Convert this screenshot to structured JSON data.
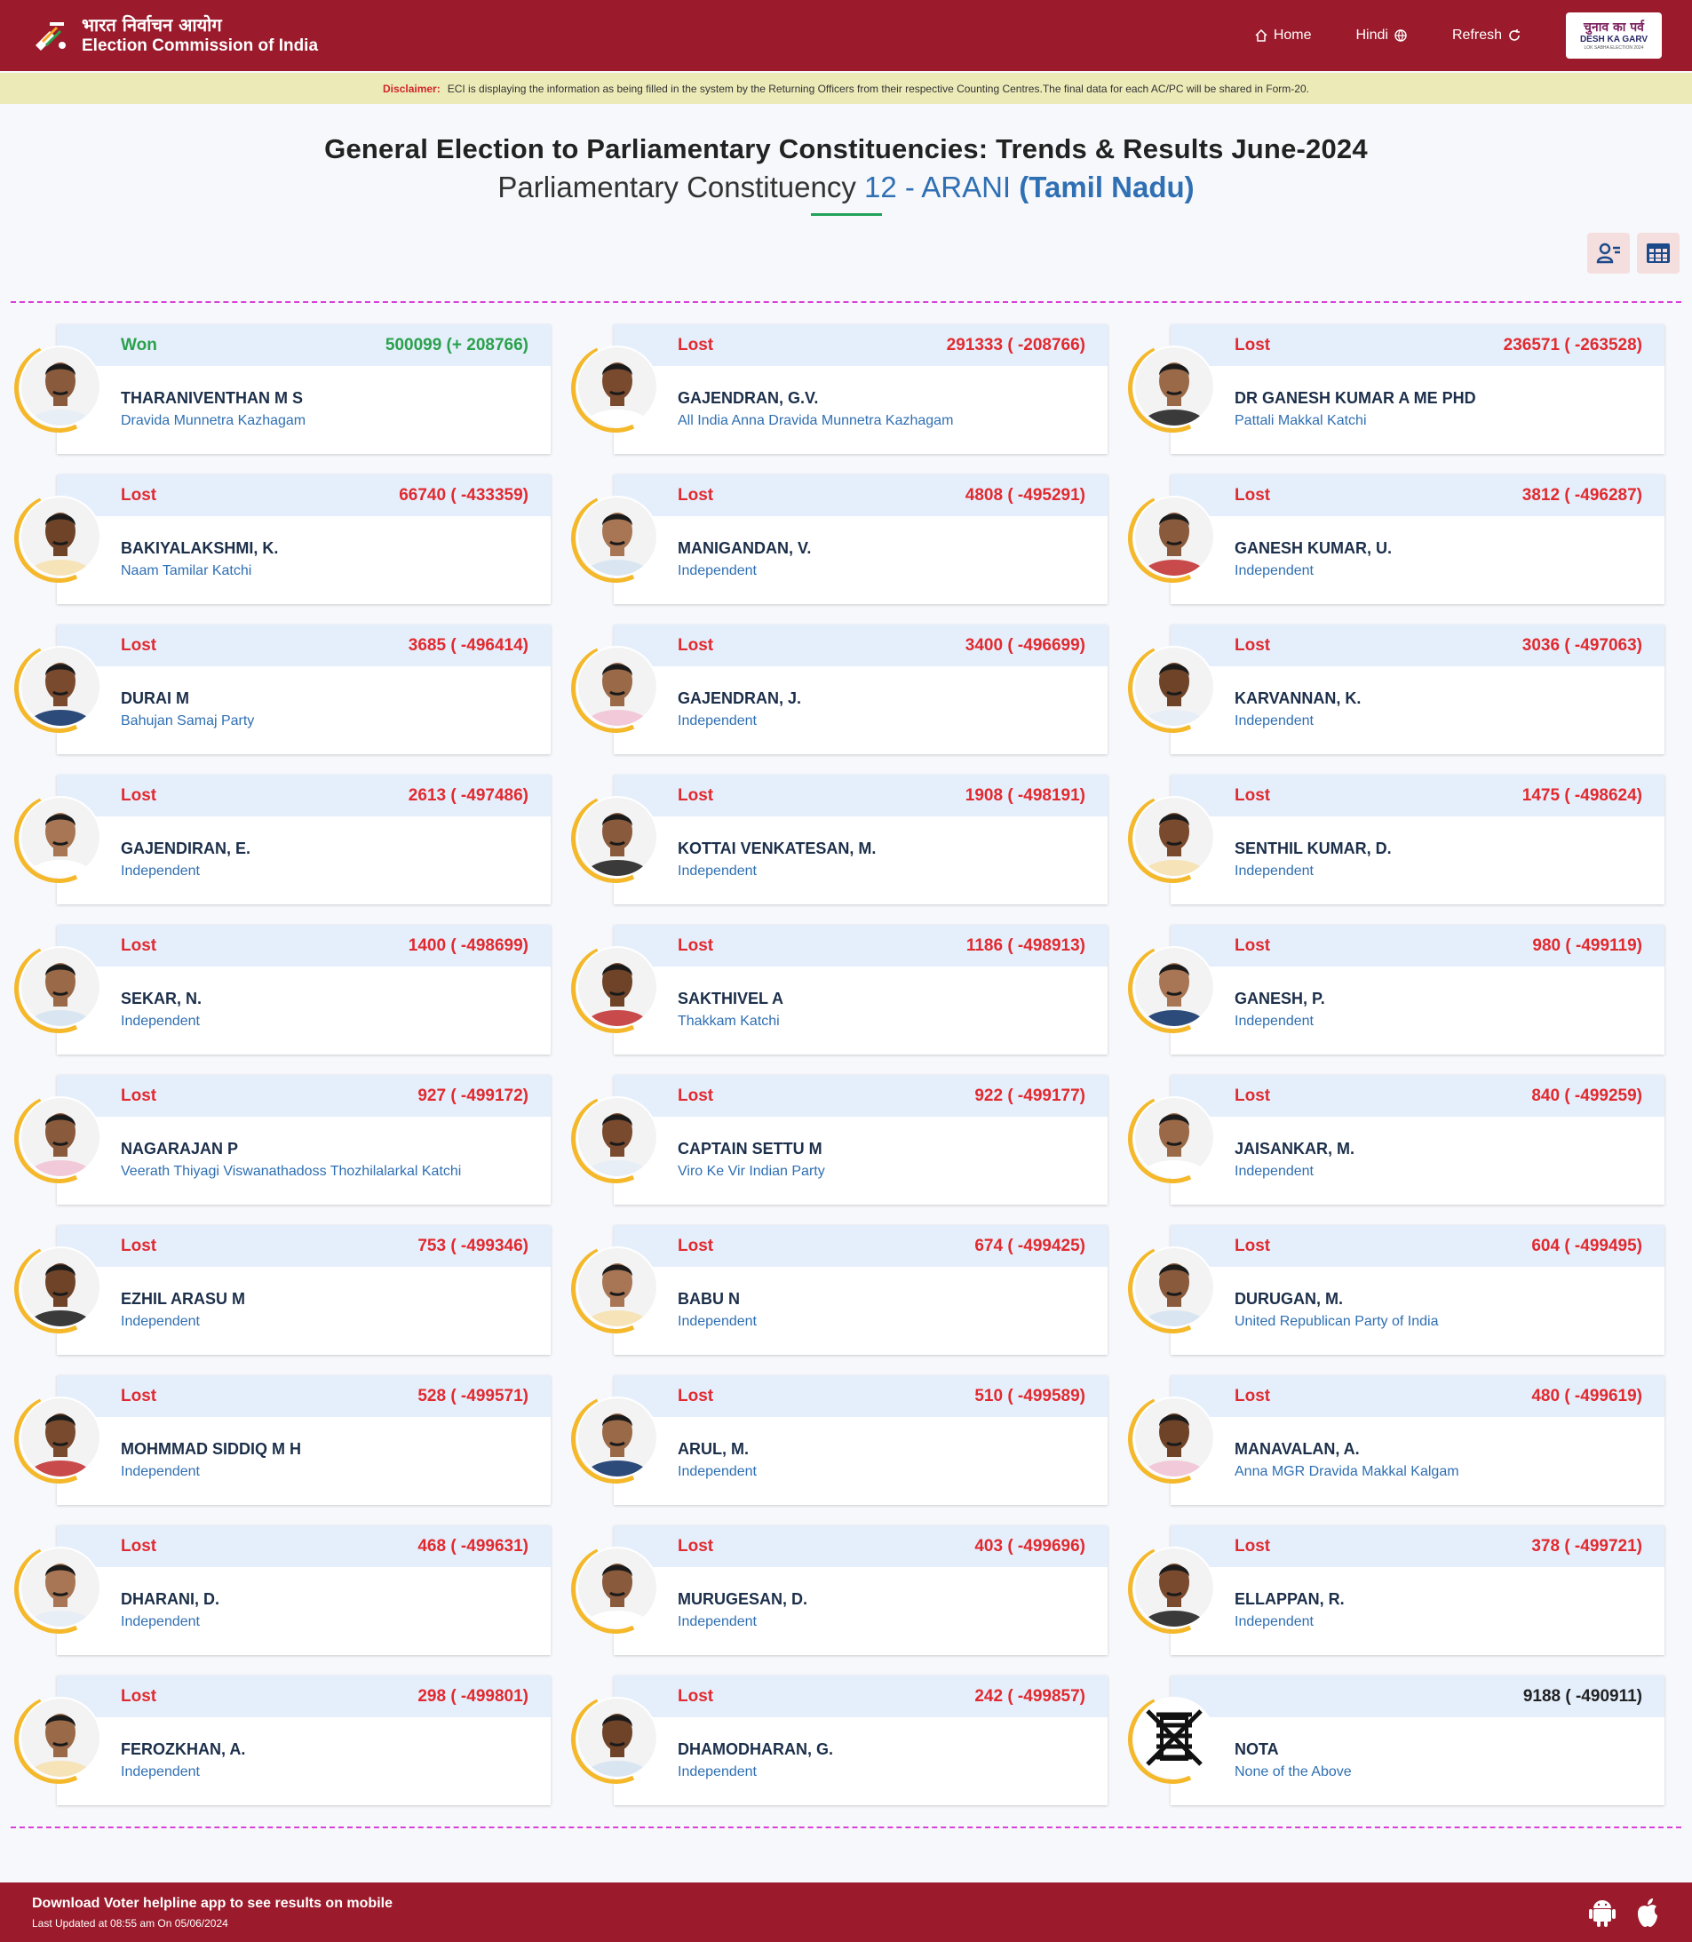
{
  "header": {
    "brand_hindi": "भारत निर्वाचन आयोग",
    "brand_english": "Election Commission of India",
    "nav": {
      "home": "Home",
      "hindi": "Hindi",
      "refresh": "Refresh"
    },
    "badge": {
      "hindi": "चुनाव का पर्व",
      "english": "DESH KA GARV",
      "small": "LOK SABHA ELECTION 2024"
    }
  },
  "disclaimer": {
    "label": "Disclaimer:",
    "text": "ECI is displaying the information as being filled in the system by the Returning Officers from their respective Counting Centres.The final data for each AC/PC will be shared in Form-20."
  },
  "title": {
    "line1": "General Election to Parliamentary Constituencies: Trends & Results June-2024",
    "line2_prefix": "Parliamentary Constituency ",
    "line2_number": "12 - ARANI ",
    "line2_state": "(Tamil Nadu)"
  },
  "candidates": [
    {
      "status": "Won",
      "votes": "500099 (+ 208766)",
      "name": "THARANIVENTHAN M S",
      "party": "Dravida Munnetra Kazhagam"
    },
    {
      "status": "Lost",
      "votes": "291333 ( -208766)",
      "name": "GAJENDRAN, G.V.",
      "party": "All India Anna Dravida Munnetra Kazhagam"
    },
    {
      "status": "Lost",
      "votes": "236571 ( -263528)",
      "name": "DR GANESH KUMAR A ME PHD",
      "party": "Pattali Makkal Katchi"
    },
    {
      "status": "Lost",
      "votes": "66740 ( -433359)",
      "name": "BAKIYALAKSHMI, K.",
      "party": "Naam Tamilar Katchi"
    },
    {
      "status": "Lost",
      "votes": "4808 ( -495291)",
      "name": "MANIGANDAN, V.",
      "party": "Independent"
    },
    {
      "status": "Lost",
      "votes": "3812 ( -496287)",
      "name": "GANESH KUMAR, U.",
      "party": "Independent"
    },
    {
      "status": "Lost",
      "votes": "3685 ( -496414)",
      "name": "DURAI M",
      "party": "Bahujan Samaj Party"
    },
    {
      "status": "Lost",
      "votes": "3400 ( -496699)",
      "name": "GAJENDRAN, J.",
      "party": "Independent"
    },
    {
      "status": "Lost",
      "votes": "3036 ( -497063)",
      "name": "KARVANNAN, K.",
      "party": "Independent"
    },
    {
      "status": "Lost",
      "votes": "2613 ( -497486)",
      "name": "GAJENDIRAN, E.",
      "party": "Independent"
    },
    {
      "status": "Lost",
      "votes": "1908 ( -498191)",
      "name": "KOTTAI VENKATESAN, M.",
      "party": "Independent"
    },
    {
      "status": "Lost",
      "votes": "1475 ( -498624)",
      "name": "SENTHIL KUMAR, D.",
      "party": "Independent"
    },
    {
      "status": "Lost",
      "votes": "1400 ( -498699)",
      "name": "SEKAR, N.",
      "party": "Independent"
    },
    {
      "status": "Lost",
      "votes": "1186 ( -498913)",
      "name": "SAKTHIVEL A",
      "party": "Thakkam Katchi"
    },
    {
      "status": "Lost",
      "votes": "980 ( -499119)",
      "name": "GANESH, P.",
      "party": "Independent"
    },
    {
      "status": "Lost",
      "votes": "927 ( -499172)",
      "name": "NAGARAJAN P",
      "party": "Veerath Thiyagi Viswanathadoss Thozhilalarkal Katchi"
    },
    {
      "status": "Lost",
      "votes": "922 ( -499177)",
      "name": "CAPTAIN SETTU M",
      "party": "Viro Ke Vir Indian Party"
    },
    {
      "status": "Lost",
      "votes": "840 ( -499259)",
      "name": "JAISANKAR, M.",
      "party": "Independent"
    },
    {
      "status": "Lost",
      "votes": "753 ( -499346)",
      "name": "EZHIL ARASU M",
      "party": "Independent"
    },
    {
      "status": "Lost",
      "votes": "674 ( -499425)",
      "name": "BABU N",
      "party": "Independent"
    },
    {
      "status": "Lost",
      "votes": "604 ( -499495)",
      "name": "DURUGAN, M.",
      "party": "United Republican Party of India"
    },
    {
      "status": "Lost",
      "votes": "528 ( -499571)",
      "name": "MOHMMAD SIDDIQ M H",
      "party": "Independent"
    },
    {
      "status": "Lost",
      "votes": "510 ( -499589)",
      "name": "ARUL, M.",
      "party": "Independent"
    },
    {
      "status": "Lost",
      "votes": "480 ( -499619)",
      "name": "MANAVALAN, A.",
      "party": "Anna MGR Dravida Makkal Kalgam"
    },
    {
      "status": "Lost",
      "votes": "468 ( -499631)",
      "name": "DHARANI, D.",
      "party": "Independent"
    },
    {
      "status": "Lost",
      "votes": "403 ( -499696)",
      "name": "MURUGESAN, D.",
      "party": "Independent"
    },
    {
      "status": "Lost",
      "votes": "378 ( -499721)",
      "name": "ELLAPPAN, R.",
      "party": "Independent"
    },
    {
      "status": "Lost",
      "votes": "298 ( -499801)",
      "name": "FEROZKHAN, A.",
      "party": "Independent"
    },
    {
      "status": "Lost",
      "votes": "242 ( -499857)",
      "name": "DHAMODHARAN, G.",
      "party": "Independent"
    },
    {
      "status": "",
      "votes": "9188 ( -490911)",
      "name": "NOTA",
      "party": "None of the Above"
    }
  ],
  "footer": {
    "line1": "Download Voter helpline app to see results on mobile",
    "line2": "Last Updated at 08:55 am On 05/06/2024"
  },
  "colors": {
    "brand": "#9b1a2b",
    "won": "#2aa14c",
    "lost": "#e12a2f",
    "link": "#2f6fb3",
    "ring": "#f4b82a"
  }
}
